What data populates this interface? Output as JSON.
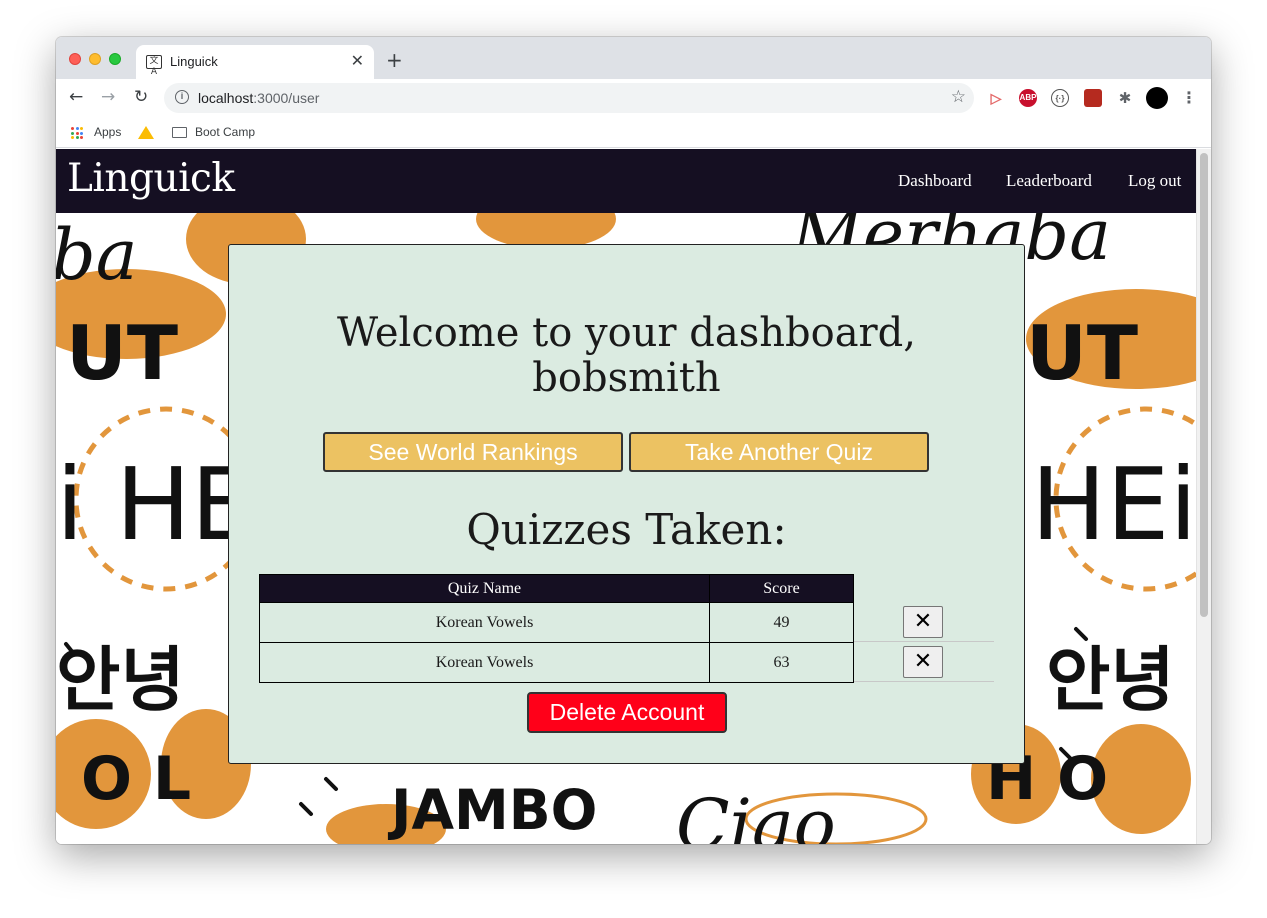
{
  "browser": {
    "tab_title": "Linguick",
    "tab_favicon": "translate-icon",
    "url_host": "localhost",
    "url_path": ":3000/user",
    "bookmarks": [
      {
        "label": "Apps",
        "icon": "apps-grid-icon"
      },
      {
        "label": "",
        "icon": "google-drive-icon"
      },
      {
        "label": "Boot Camp",
        "icon": "folder-icon"
      }
    ]
  },
  "site": {
    "brand": "Linguick",
    "nav": {
      "dashboard": "Dashboard",
      "leaderboard": "Leaderboard",
      "logout": "Log out"
    }
  },
  "dashboard": {
    "welcome_line1": "Welcome to your dashboard,",
    "welcome_line2": "bobsmith",
    "see_rankings_label": "See World Rankings",
    "take_quiz_label": "Take Another Quiz",
    "quizzes_heading": "Quizzes Taken:",
    "table": {
      "headers": {
        "name": "Quiz Name",
        "score": "Score"
      },
      "rows": [
        {
          "name": "Korean Vowels",
          "score": "49"
        },
        {
          "name": "Korean Vowels",
          "score": "63"
        }
      ],
      "delete_symbol": "✕"
    },
    "delete_account_label": "Delete Account"
  },
  "colors": {
    "navbar_bg": "#150f22",
    "card_bg": "#dbebe1",
    "gold_button": "#ecc262",
    "danger_button": "#ff0019",
    "art_orange": "#e2963c"
  }
}
